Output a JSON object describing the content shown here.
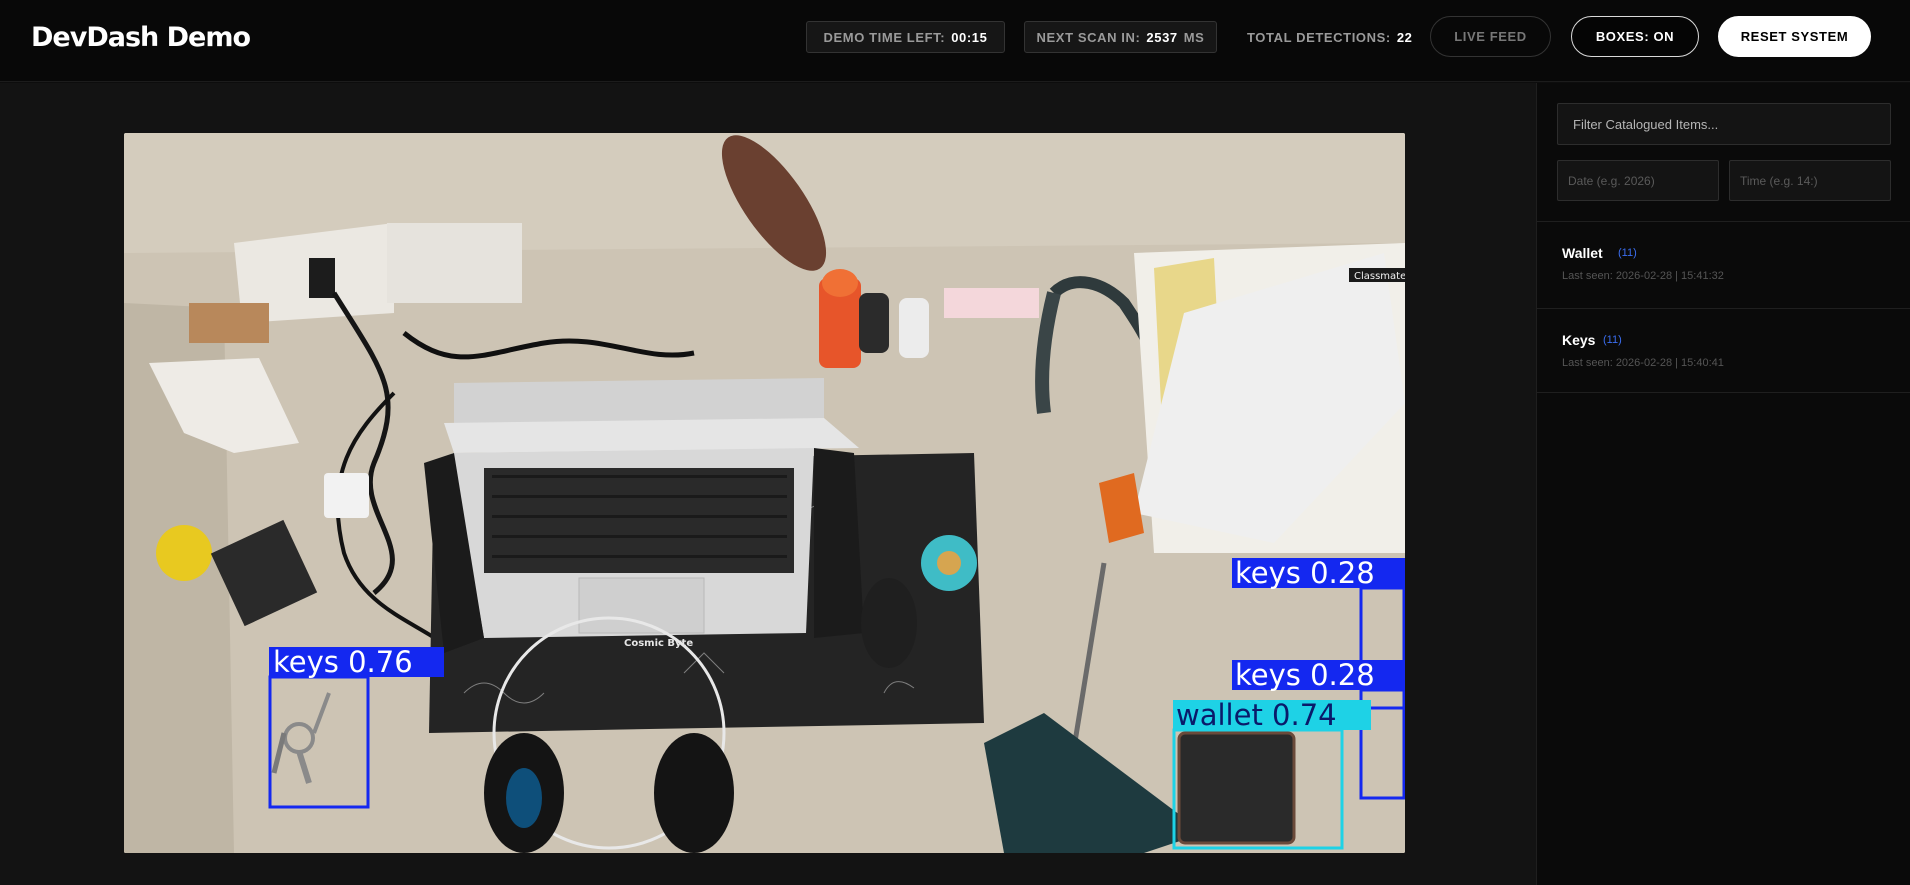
{
  "header": {
    "title": "DevDash Demo",
    "demo_time": {
      "label": "DEMO TIME LEFT:",
      "value": "00:15"
    },
    "next_scan": {
      "label": "NEXT SCAN IN:",
      "value": "2537",
      "unit": "MS"
    },
    "total_detections": {
      "label": "TOTAL DETECTIONS:",
      "value": "22"
    },
    "live_feed_label": "LIVE FEED",
    "boxes_label": "BOXES: ON",
    "reset_label": "RESET SYSTEM"
  },
  "feed": {
    "detections": [
      {
        "label": "keys 0.76",
        "class": "keys",
        "confidence": 0.76,
        "color": "#1428f0"
      },
      {
        "label": "keys 0.28",
        "class": "keys",
        "confidence": 0.28,
        "color": "#1428f0"
      },
      {
        "label": "keys 0.28",
        "class": "keys",
        "confidence": 0.28,
        "color": "#1428f0"
      },
      {
        "label": "wallet 0.74",
        "class": "wallet",
        "confidence": 0.74,
        "color": "#1ed2e6"
      }
    ],
    "desk_labels": {
      "notebook": "Classmate",
      "mousepad": "Cosmic Byte"
    }
  },
  "sidebar": {
    "filter_placeholder": "Filter Catalogued Items...",
    "date_placeholder": "Date (e.g. 2026)",
    "time_placeholder": "Time (e.g. 14:)",
    "items": [
      {
        "name": "Wallet",
        "count": "(11)",
        "last_seen": "Last seen: 2026-02-28 | 15:41:32"
      },
      {
        "name": "Keys",
        "count": "(11)",
        "last_seen": "Last seen: 2026-02-28 | 15:40:41"
      }
    ]
  },
  "colors": {
    "accent_blue": "#3b6ef0",
    "keys_box": "#1428f0",
    "wallet_box": "#1ed2e6",
    "background": "#0d0d0d"
  }
}
